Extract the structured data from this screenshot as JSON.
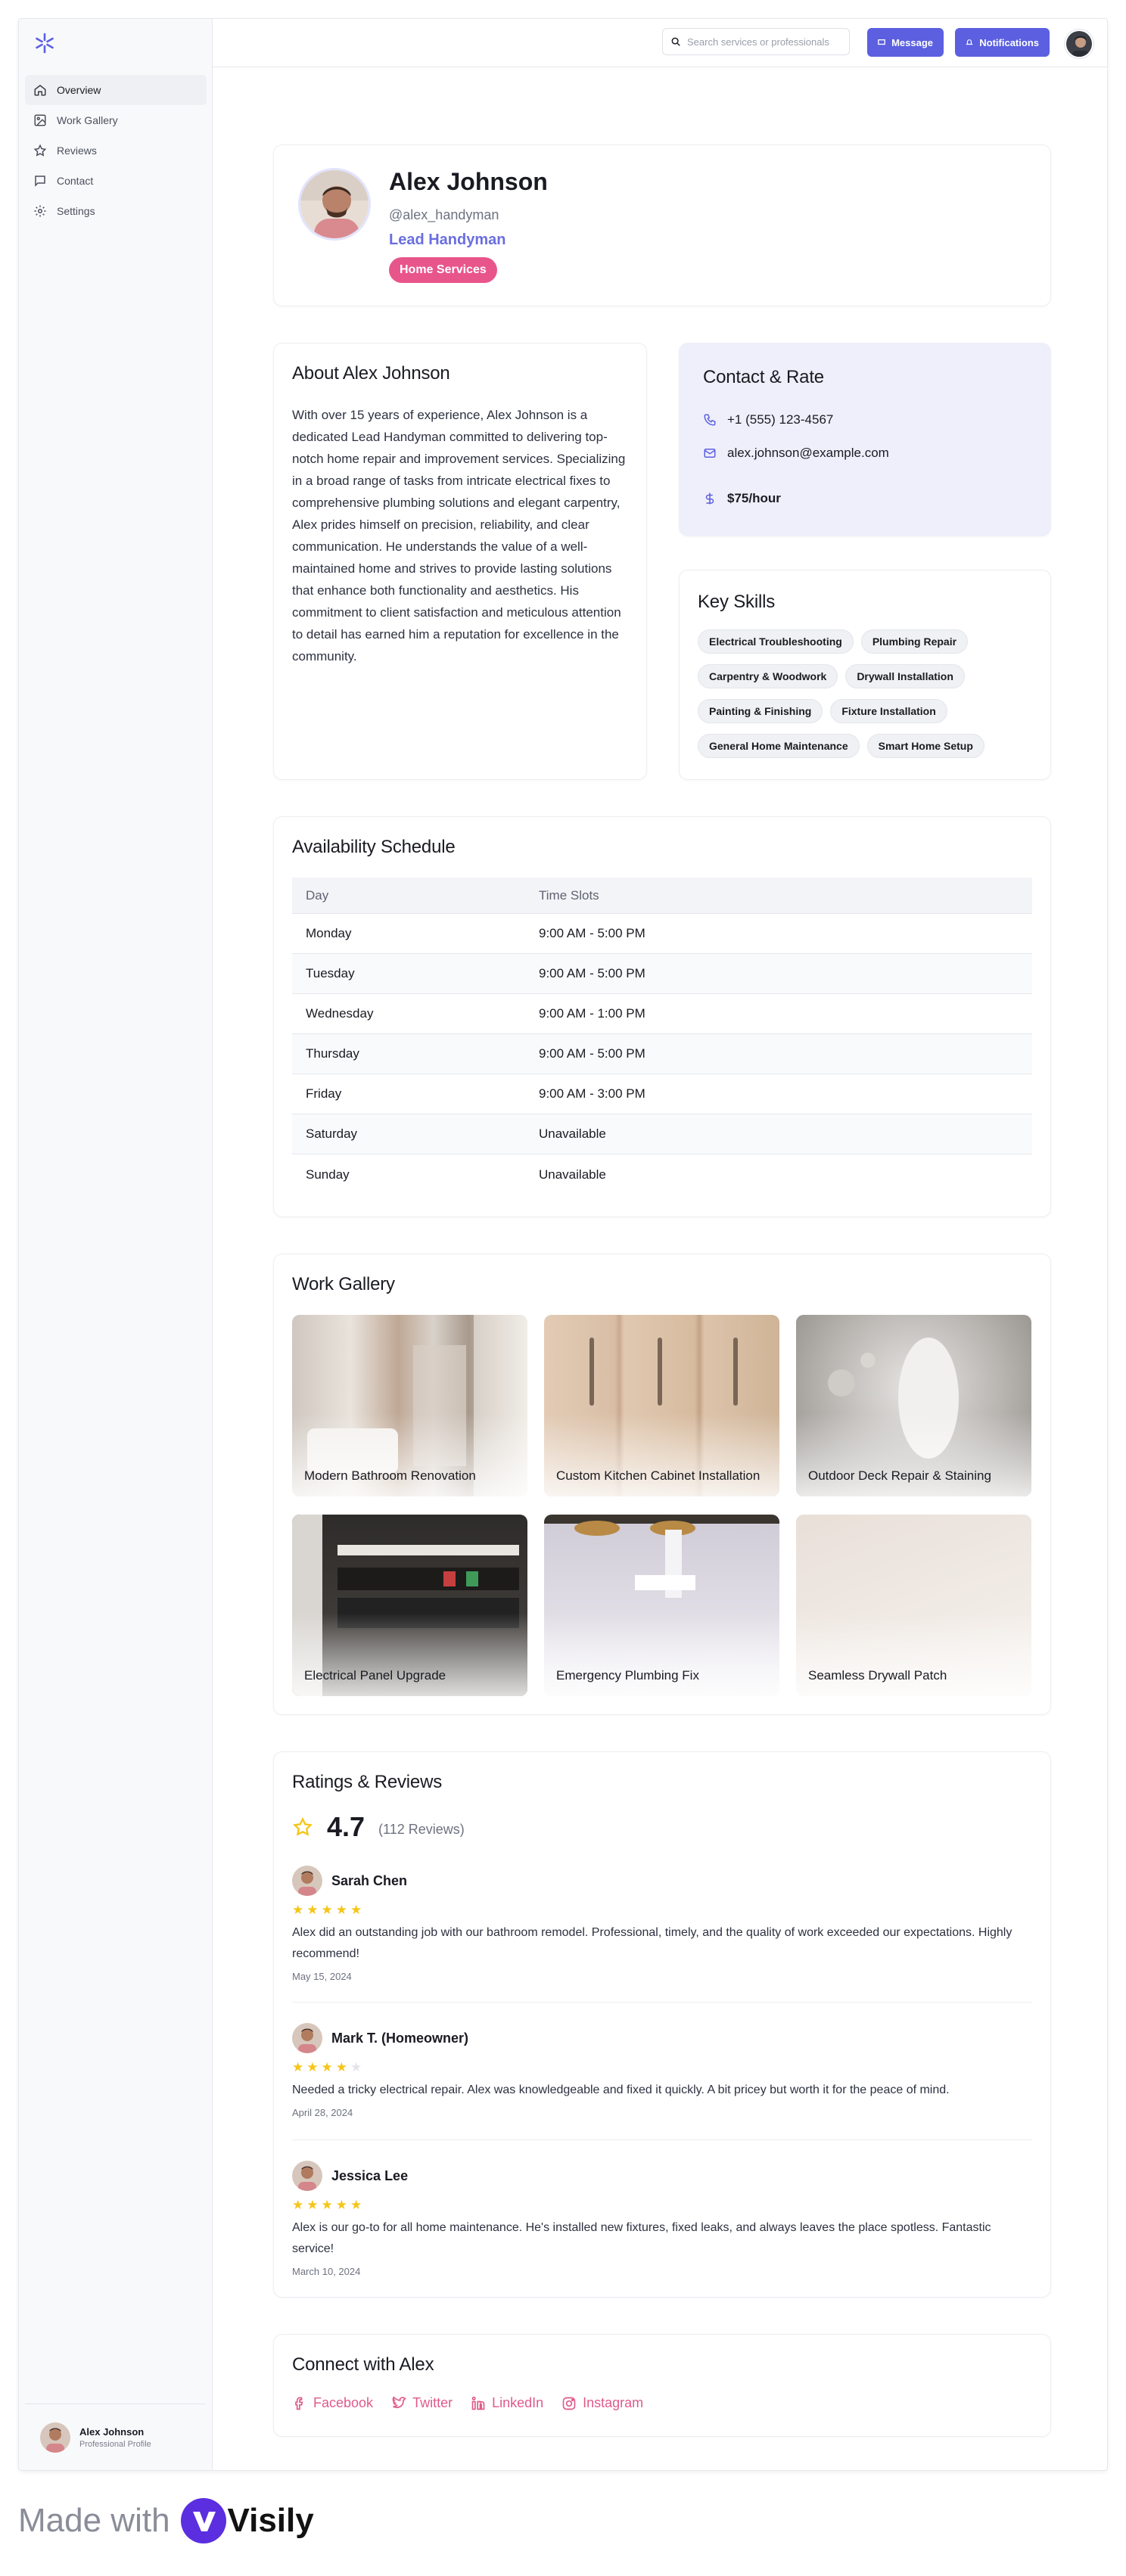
{
  "sidebar": {
    "items": [
      {
        "label": "Overview",
        "icon": "home-icon",
        "active": true
      },
      {
        "label": "Work Gallery",
        "icon": "image-icon",
        "active": false
      },
      {
        "label": "Reviews",
        "icon": "star-icon",
        "active": false
      },
      {
        "label": "Contact",
        "icon": "message-icon",
        "active": false
      },
      {
        "label": "Settings",
        "icon": "gear-icon",
        "active": false
      }
    ],
    "footer": {
      "name": "Alex Johnson",
      "role": "Professional Profile"
    }
  },
  "topbar": {
    "search_placeholder": "Search services or professionals",
    "message_label": "Message",
    "notifications_label": "Notifications"
  },
  "profile": {
    "name": "Alex Johnson",
    "handle": "@alex_handyman",
    "title": "Lead Handyman",
    "badge": "Home Services"
  },
  "about": {
    "heading": "About Alex Johnson",
    "text": "With over 15 years of experience, Alex Johnson is a dedicated Lead Handyman committed to delivering top-notch home repair and improvement services. Specializing in a broad range of tasks from intricate electrical fixes to comprehensive plumbing solutions and elegant carpentry, Alex prides himself on precision, reliability, and clear communication. He understands the value of a well-maintained home and strives to provide lasting solutions that enhance both functionality and aesthetics. His commitment to client satisfaction and meticulous attention to detail has earned him a reputation for excellence in the community."
  },
  "contact": {
    "heading": "Contact & Rate",
    "phone": "+1 (555) 123-4567",
    "email": "alex.johnson@example.com",
    "rate": "$75/hour"
  },
  "skills": {
    "heading": "Key Skills",
    "items": [
      "Electrical Troubleshooting",
      "Plumbing Repair",
      "Carpentry & Woodwork",
      "Drywall Installation",
      "Painting & Finishing",
      "Fixture Installation",
      "General Home Maintenance",
      "Smart Home Setup"
    ]
  },
  "schedule": {
    "heading": "Availability Schedule",
    "columns": [
      "Day",
      "Time Slots"
    ],
    "rows": [
      [
        "Monday",
        "9:00 AM - 5:00 PM"
      ],
      [
        "Tuesday",
        "9:00 AM - 5:00 PM"
      ],
      [
        "Wednesday",
        "9:00 AM - 1:00 PM"
      ],
      [
        "Thursday",
        "9:00 AM - 5:00 PM"
      ],
      [
        "Friday",
        "9:00 AM - 3:00 PM"
      ],
      [
        "Saturday",
        "Unavailable"
      ],
      [
        "Sunday",
        "Unavailable"
      ]
    ]
  },
  "gallery": {
    "heading": "Work Gallery",
    "items": [
      "Modern Bathroom Renovation",
      "Custom Kitchen Cabinet Installation",
      "Outdoor Deck Repair & Staining",
      "Electrical Panel Upgrade",
      "Emergency Plumbing Fix",
      "Seamless Drywall Patch"
    ]
  },
  "reviews": {
    "heading": "Ratings & Reviews",
    "average": "4.7",
    "count": "(112 Reviews)",
    "items": [
      {
        "name": "Sarah Chen",
        "stars": 5,
        "text": "Alex did an outstanding job with our bathroom remodel. Professional, timely, and the quality of work exceeded our expectations. Highly recommend!",
        "date": "May 15, 2024"
      },
      {
        "name": "Mark T. (Homeowner)",
        "stars": 4,
        "text": "Needed a tricky electrical repair. Alex was knowledgeable and fixed it quickly. A bit pricey but worth it for the peace of mind.",
        "date": "April 28, 2024"
      },
      {
        "name": "Jessica Lee",
        "stars": 5,
        "text": "Alex is our go-to for all home maintenance. He's installed new fixtures, fixed leaks, and always leaves the place spotless. Fantastic service!",
        "date": "March 10, 2024"
      }
    ]
  },
  "social": {
    "heading": "Connect with Alex",
    "links": [
      "Facebook",
      "Twitter",
      "LinkedIn",
      "Instagram"
    ]
  },
  "footer_badge": {
    "prefix": "Made with",
    "brand": "Visily"
  },
  "colors": {
    "accent": "#5b5fe0",
    "pink": "#e8558a",
    "star": "#f5c518"
  }
}
